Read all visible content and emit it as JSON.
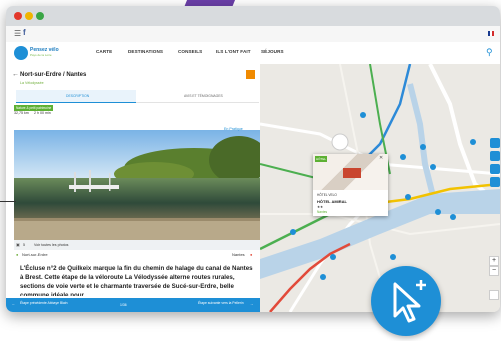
{
  "browser": {
    "url_icons": [
      "settings-icon",
      "facebook-icon"
    ],
    "dot_colors": [
      "#e2372b",
      "#f0b400",
      "#3aa545"
    ]
  },
  "navbar": {
    "logo_text": "Pensez vélo",
    "logo_sub": "Pays de la Loire",
    "items": [
      "CARTE",
      "DESTINATIONS",
      "CONSEILS",
      "ILS L'ONT FAIT",
      "SÉJOURS"
    ]
  },
  "route": {
    "title": "Nort-sur-Erdre / Nantes",
    "subtitle": "La Vélodyssée",
    "tabs": [
      "DESCRIPTION",
      "AVIS ET TÉMOIGNAGES"
    ],
    "badge": "Nature & petit patrimoine",
    "distance": "32,75 km",
    "duration": "2 h 00 min",
    "pdf_link": "En Pratique",
    "photo_caption_left": "Voir toutes les photos",
    "photo_count": "5",
    "start": "Nort-sur-Erdre",
    "end": "Nantes",
    "description": "L'Écluse n°2 de Quilkeix marque la fin du chemin de halage du canal de Nantes à Brest. Cette étape de la véloroute La Vélodyssée alterne routes rurales, sections de voie verte et le charmante traversée de Sucé-sur-Erdre, belle commune idéale pour"
  },
  "bottombar": {
    "prev": "Étape précédente Abbaye Blain",
    "middle": "1/36",
    "next": "Étape suivante vers la Pellerin"
  },
  "map_popup": {
    "tag": "HÔTEL",
    "category": "HÔTEL VELO",
    "name": "HÔTEL AMIRAL",
    "stars": "★★",
    "city": "Nantes"
  },
  "colors": {
    "brand_blue": "#1e8fd6",
    "green": "#5db033",
    "route_blue": "#2d8ad8",
    "route_green": "#4caf50",
    "route_yellow": "#f2c200",
    "route_red": "#e24a3a",
    "deco_purple": "#6b3fa8"
  }
}
